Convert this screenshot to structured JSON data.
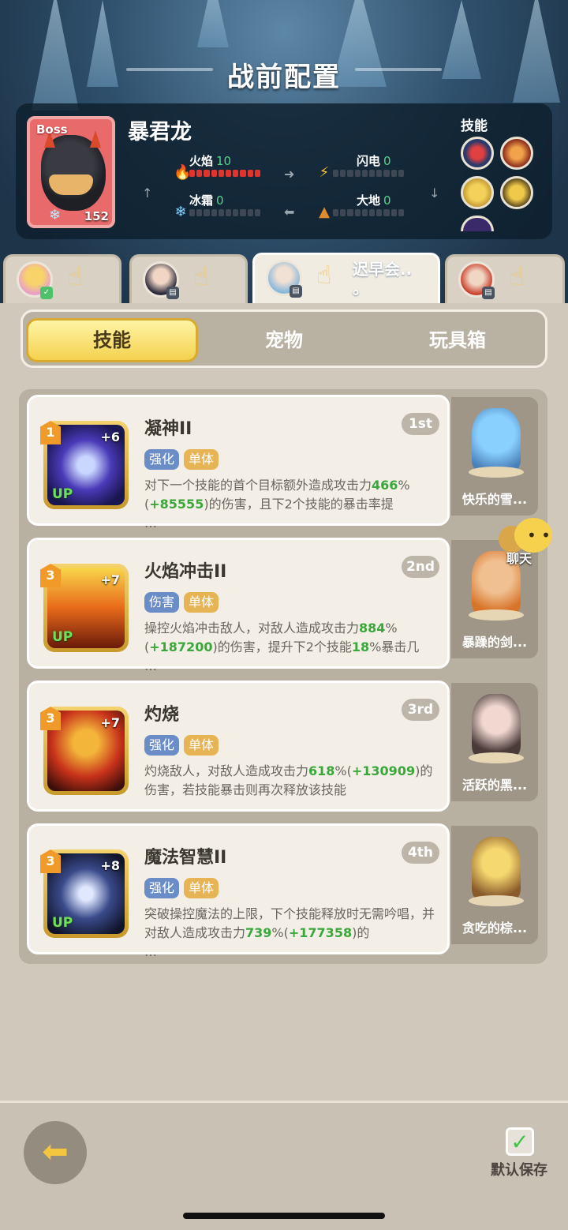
{
  "page_title": "战前配置",
  "boss": {
    "tag": "Boss",
    "name": "暴君龙",
    "level": "152",
    "skills_label": "技能",
    "elements": [
      {
        "name": "火焰",
        "value": "10",
        "filled": 10,
        "color": "#e0342d"
      },
      {
        "name": "闪电",
        "value": "0",
        "filled": 0,
        "color": "#f4c430"
      },
      {
        "name": "冰霜",
        "value": "0",
        "filled": 0,
        "color": "#7fd3ff"
      },
      {
        "name": "大地",
        "value": "0",
        "filled": 0,
        "color": "#e08a2a"
      }
    ]
  },
  "heroes": [
    {
      "name": "",
      "active": false
    },
    {
      "name": "",
      "active": false
    },
    {
      "name": "迟早会..\n。",
      "active": true
    },
    {
      "name": "",
      "active": false
    }
  ],
  "tabs": {
    "skills": "技能",
    "pets": "宠物",
    "toybox": "玩具箱"
  },
  "skills": [
    {
      "level": "1",
      "plus": "+6",
      "up": "UP",
      "name": "凝神II",
      "rank": "1st",
      "tags": [
        "强化",
        "单体"
      ],
      "desc_parts": [
        "对下一个技能的首个目标额外造成攻击力",
        "466",
        "%(",
        "+85555",
        ")的伤害，且下2个技能的暴击率提",
        "\n…"
      ],
      "pet_name": "快乐的雪..."
    },
    {
      "level": "3",
      "plus": "+7",
      "up": "UP",
      "name": "火焰冲击II",
      "rank": "2nd",
      "tags": [
        "伤害",
        "单体"
      ],
      "desc_parts": [
        "操控火焰冲击敌人，对敌人造成攻击力",
        "884",
        "%(",
        "+187200",
        ")的伤害，提升下2个技能",
        "18",
        "%暴击几",
        "\n…"
      ],
      "pet_name": "暴躁的剑..."
    },
    {
      "level": "3",
      "plus": "+7",
      "up": "",
      "name": "灼烧",
      "rank": "3rd",
      "tags": [
        "强化",
        "单体"
      ],
      "desc_parts": [
        "灼烧敌人，对敌人造成攻击力",
        "618",
        "%(",
        "+130909",
        ")的伤害，若技能暴击则再次释放该技能"
      ],
      "pet_name": "活跃的黑..."
    },
    {
      "level": "3",
      "plus": "+8",
      "up": "UP",
      "name": "魔法智慧II",
      "rank": "4th",
      "tags": [
        "强化",
        "单体"
      ],
      "desc_parts": [
        "突破操控魔法的上限，下个技能释放时无需吟唱，并对敌人造成攻击力",
        "739",
        "%(",
        "+177358",
        ")的",
        "\n…"
      ],
      "pet_name": "贪吃的棕..."
    }
  ],
  "chat_label": "聊天",
  "save_label": "默认保存",
  "colors": {
    "accent_gold": "#f4d24e",
    "highlight_green": "#3aa73a",
    "tag_blue": "#6a8dc8",
    "tag_orange": "#e6b455"
  }
}
